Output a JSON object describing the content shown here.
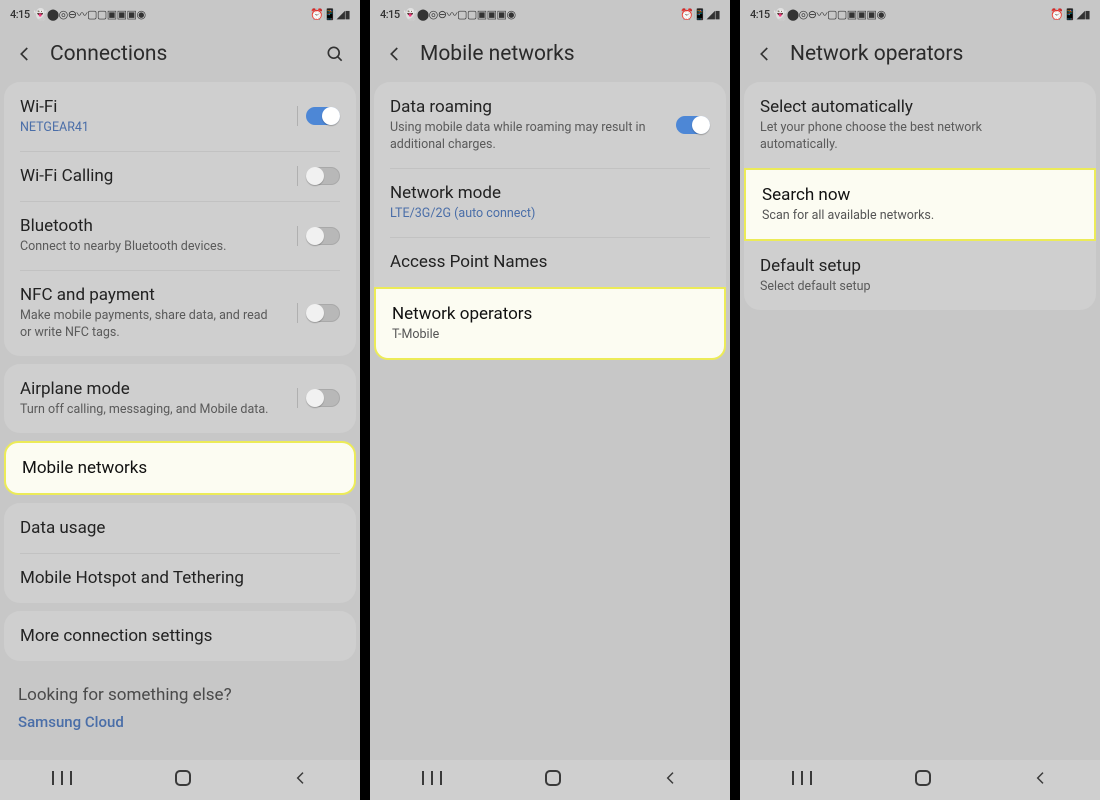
{
  "status": {
    "time": "4:15",
    "left_icons": "👻⬤◎⊖〰▢▢▣▣▣◉",
    "right_icons": "⏰📳◢▮"
  },
  "screen1": {
    "title": "Connections",
    "wifi": {
      "label": "Wi-Fi",
      "network": "NETGEAR41",
      "on": true
    },
    "wifi_calling": {
      "label": "Wi-Fi Calling",
      "on": false
    },
    "bluetooth": {
      "label": "Bluetooth",
      "sub": "Connect to nearby Bluetooth devices.",
      "on": false
    },
    "nfc": {
      "label": "NFC and payment",
      "sub": "Make mobile payments, share data, and read or write NFC tags.",
      "on": false
    },
    "airplane": {
      "label": "Airplane mode",
      "sub": "Turn off calling, messaging, and Mobile data.",
      "on": false
    },
    "mobile_networks": {
      "label": "Mobile networks"
    },
    "data_usage": {
      "label": "Data usage"
    },
    "hotspot": {
      "label": "Mobile Hotspot and Tethering"
    },
    "more": {
      "label": "More connection settings"
    },
    "looking": "Looking for something else?",
    "cloud": "Samsung Cloud"
  },
  "screen2": {
    "title": "Mobile networks",
    "roaming": {
      "label": "Data roaming",
      "sub": "Using mobile data while roaming may result in additional charges.",
      "on": true
    },
    "mode": {
      "label": "Network mode",
      "sub": "LTE/3G/2G (auto connect)"
    },
    "apn": {
      "label": "Access Point Names"
    },
    "operators": {
      "label": "Network operators",
      "sub": "T-Mobile"
    }
  },
  "screen3": {
    "title": "Network operators",
    "auto": {
      "label": "Select automatically",
      "sub": "Let your phone choose the best network automatically."
    },
    "search": {
      "label": "Search now",
      "sub": "Scan for all available networks."
    },
    "default": {
      "label": "Default setup",
      "sub": "Select default setup"
    }
  }
}
